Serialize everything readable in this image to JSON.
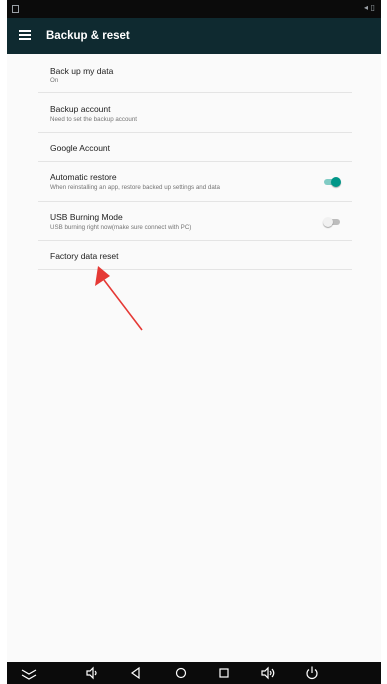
{
  "app_bar": {
    "title": "Backup & reset"
  },
  "settings": [
    {
      "label": "Back up my data",
      "sub": "On"
    },
    {
      "label": "Backup account",
      "sub": "Need to set the backup account"
    },
    {
      "label": "Google Account",
      "sub": ""
    },
    {
      "label": "Automatic restore",
      "sub": "When reinstalling an app, restore backed up settings and data",
      "toggle": "on"
    },
    {
      "label": "USB Burning Mode",
      "sub": "USB burning right now(make sure connect with PC)",
      "toggle": "off"
    },
    {
      "label": "Factory data reset",
      "sub": ""
    }
  ],
  "nav_icons": [
    "collapse-chevron-icon",
    "volume-down-icon",
    "back-icon",
    "home-icon",
    "recents-icon",
    "volume-up-icon",
    "power-icon"
  ],
  "colors": {
    "app_bar": "#0f2a30",
    "accent": "#009688",
    "annotation_arrow": "#e53935"
  }
}
